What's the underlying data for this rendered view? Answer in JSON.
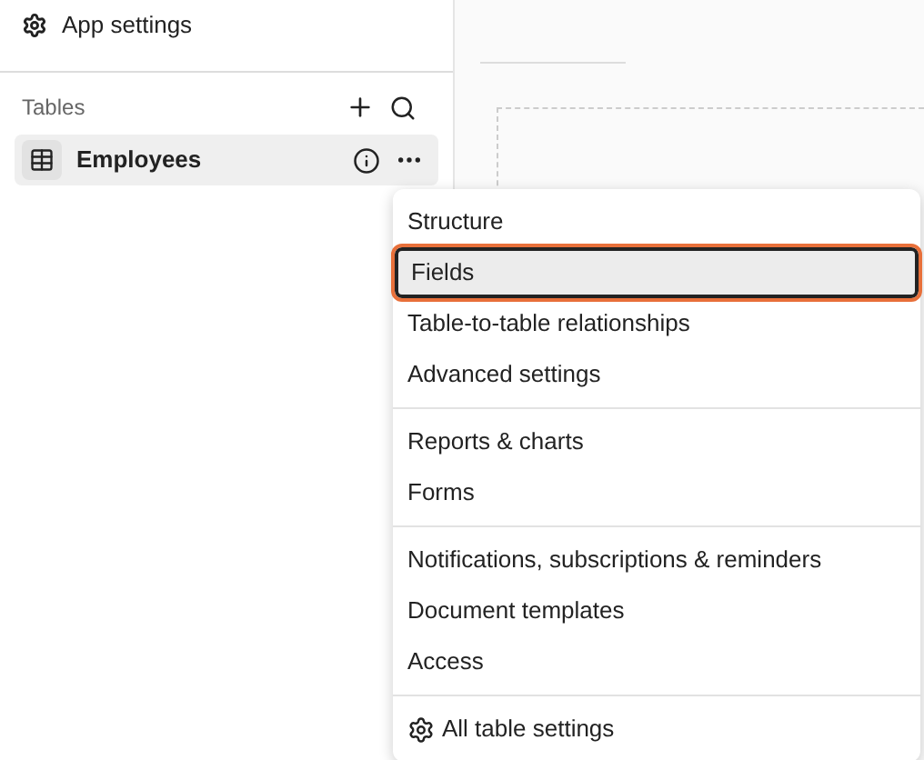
{
  "sidebar": {
    "app_settings": "App settings",
    "tables_heading": "Tables",
    "tables": [
      {
        "label": "Employees",
        "selected": true
      }
    ]
  },
  "menu": {
    "groups": [
      {
        "items": [
          {
            "label": "Structure",
            "selected": false
          },
          {
            "label": "Fields",
            "selected": true
          },
          {
            "label": "Table-to-table relationships",
            "selected": false
          },
          {
            "label": "Advanced settings",
            "selected": false
          }
        ]
      },
      {
        "items": [
          {
            "label": "Reports & charts",
            "selected": false
          },
          {
            "label": "Forms",
            "selected": false
          }
        ]
      },
      {
        "items": [
          {
            "label": "Notifications, subscriptions & reminders",
            "selected": false
          },
          {
            "label": "Document templates",
            "selected": false
          },
          {
            "label": "Access",
            "selected": false
          }
        ]
      },
      {
        "items": [
          {
            "label": "All table settings",
            "selected": false,
            "kind": "settings"
          }
        ]
      }
    ]
  }
}
